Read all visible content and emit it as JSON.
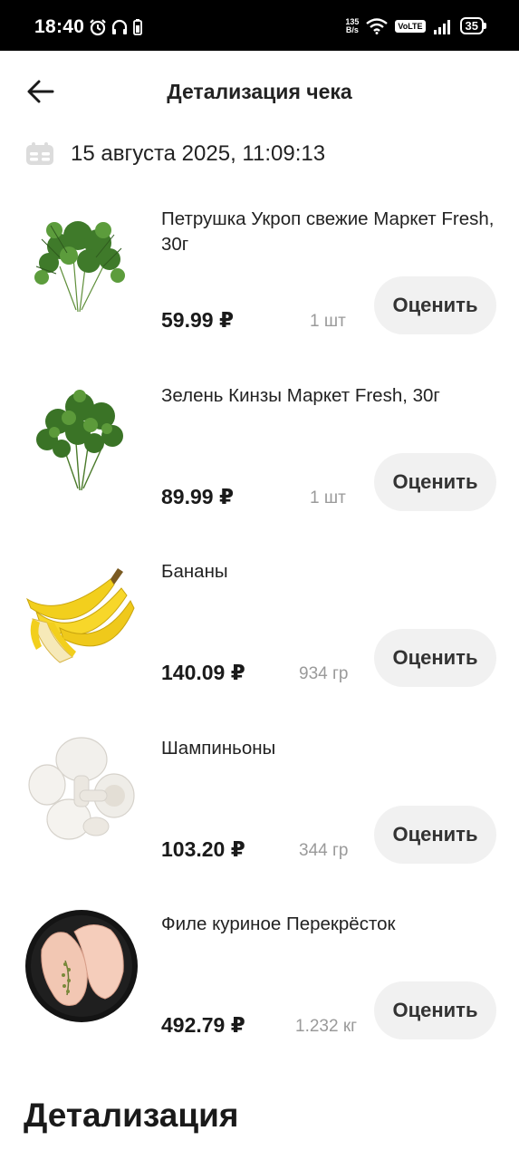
{
  "status_bar": {
    "time": "18:40",
    "net_speed_value": "135",
    "net_speed_unit": "B/s",
    "volte": "VoLTE",
    "battery": "35"
  },
  "header": {
    "title": "Детализация чека"
  },
  "receipt": {
    "date": "15 августа 2025, 11:09:13"
  },
  "items": [
    {
      "name": "Петрушка Укроп свежие Маркет Fresh, 30г",
      "price": "59.99 ₽",
      "qty": "1 шт",
      "rate_label": "Оценить",
      "image_icon": "herbs-dill-parsley"
    },
    {
      "name": "Зелень Кинзы Маркет Fresh, 30г",
      "price": "89.99 ₽",
      "qty": "1 шт",
      "rate_label": "Оценить",
      "image_icon": "cilantro-bunch"
    },
    {
      "name": "Бананы",
      "price": "140.09 ₽",
      "qty": "934 гр",
      "rate_label": "Оценить",
      "image_icon": "bananas"
    },
    {
      "name": "Шампиньоны",
      "price": "103.20 ₽",
      "qty": "344 гр",
      "rate_label": "Оценить",
      "image_icon": "mushrooms"
    },
    {
      "name": "Филе куриное Перекрёсток",
      "price": "492.79 ₽",
      "qty": "1.232 кг",
      "rate_label": "Оценить",
      "image_icon": "chicken-fillet-plate"
    }
  ],
  "section": {
    "title": "Детализация"
  },
  "colors": {
    "background": "#ffffff",
    "status_bar": "#000000",
    "button_bg": "#f1f1f1",
    "muted_text": "#9a9a9a"
  }
}
